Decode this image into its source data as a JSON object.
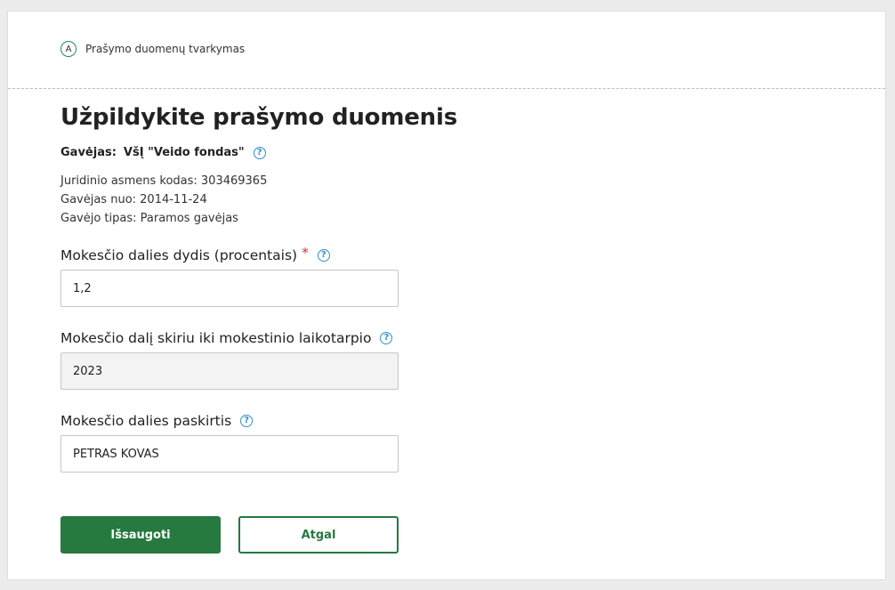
{
  "step": {
    "letter": "A",
    "label": "Prašymo duomenų tvarkymas"
  },
  "page": {
    "title": "Užpildykite prašymo duomenis"
  },
  "recipient": {
    "label": "Gavėjas:",
    "name": "VšĮ \"Veido fondas\"",
    "code_line": "Juridinio asmens kodas: 303469365",
    "since_line": "Gavėjas nuo: 2014-11-24",
    "type_line": "Gavėjo tipas: Paramos gavėjas"
  },
  "fields": {
    "percent": {
      "label": "Mokesčio dalies dydis (procentais)",
      "required_mark": "*",
      "value": "1,2"
    },
    "period": {
      "label": "Mokesčio dalį skiriu iki mokestinio laikotarpio",
      "value": "2023"
    },
    "purpose": {
      "label": "Mokesčio dalies paskirtis",
      "value": "PETRAS KOVAS"
    }
  },
  "help_symbol": "?",
  "buttons": {
    "save": "Išsaugoti",
    "back": "Atgal"
  },
  "colors": {
    "primary_green": "#26793f",
    "help_blue": "#2f8fc8",
    "required_red": "#d0342c"
  }
}
